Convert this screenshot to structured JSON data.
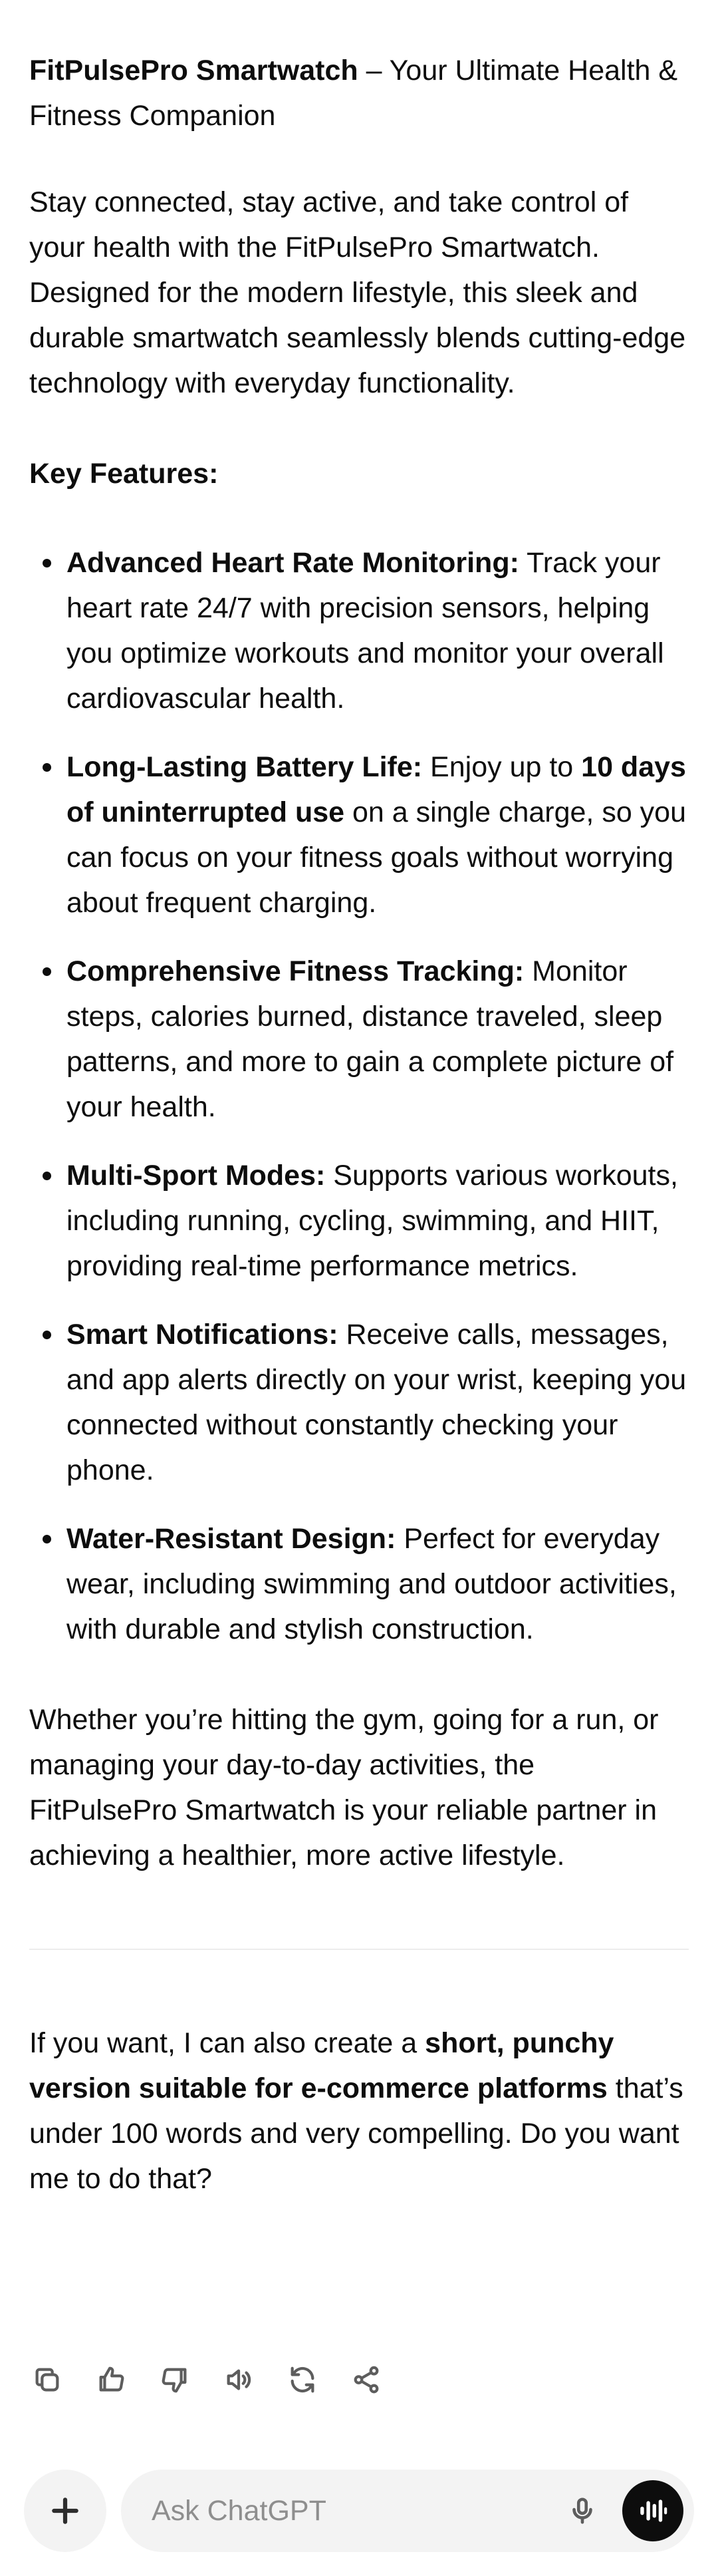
{
  "message": {
    "title_bold": "FitPulsePro Smartwatch",
    "title_rest": " – Your Ultimate Health & Fitness Companion",
    "intro": "Stay connected, stay active, and take control of your health with the FitPulsePro Smartwatch. Designed for the modern lifestyle, this sleek and durable smartwatch seamlessly blends cutting-edge technology with everyday functionality.",
    "key_features_heading": "Key Features:",
    "features": [
      {
        "title": "Advanced Heart Rate Monitoring:",
        "text": " Track your heart rate 24/7 with precision sensors, helping you optimize workouts and monitor your overall cardiovascular health."
      },
      {
        "title": "Long-Lasting Battery Life:",
        "text_a": " Enjoy up to ",
        "bold_mid": "10 days of uninterrupted use",
        "text_b": " on a single charge, so you can focus on your fitness goals without worrying about frequent charging."
      },
      {
        "title": "Comprehensive Fitness Tracking:",
        "text": " Monitor steps, calories burned, distance traveled, sleep patterns, and more to gain a complete picture of your health."
      },
      {
        "title": "Multi-Sport Modes:",
        "text": " Supports various workouts, including running, cycling, swimming, and HIIT, providing real-time performance metrics."
      },
      {
        "title": "Smart Notifications:",
        "text": " Receive calls, messages, and app alerts directly on your wrist, keeping you connected without constantly checking your phone."
      },
      {
        "title": "Water-Resistant Design:",
        "text": " Perfect for everyday wear, including swimming and outdoor activities, with durable and stylish construction."
      }
    ],
    "closing": "Whether you’re hitting the gym, going for a run, or managing your day-to-day activities, the FitPulsePro Smartwatch is your reliable partner in achieving a healthier, more active lifestyle.",
    "followup_a": "If you want, I can also create a ",
    "followup_bold": "short, punchy version suitable for e-commerce platforms",
    "followup_b": " that’s under 100 words and very compelling. Do you want me to do that?"
  },
  "actions": [
    "copy-icon",
    "thumbs-up-icon",
    "thumbs-down-icon",
    "speaker-icon",
    "regenerate-icon",
    "share-icon"
  ],
  "composer": {
    "placeholder": "Ask ChatGPT"
  }
}
